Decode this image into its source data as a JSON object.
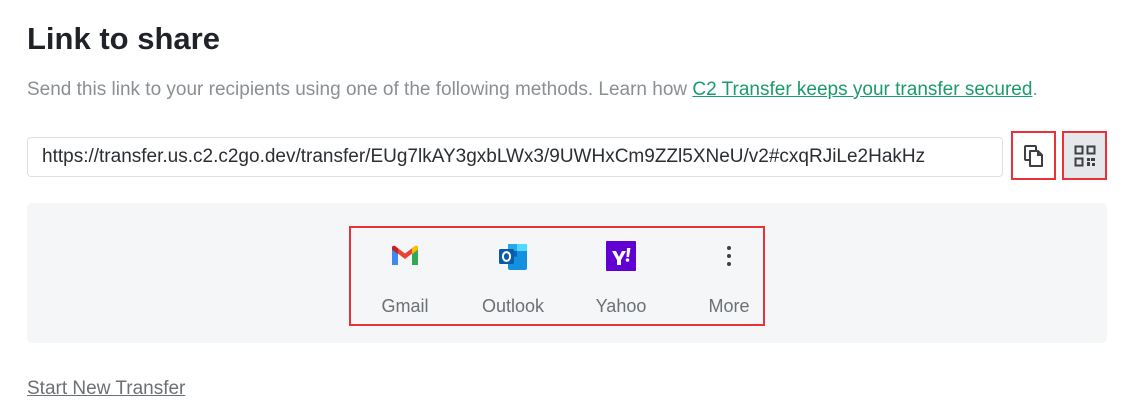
{
  "page": {
    "title": "Link to share",
    "description_prefix": "Send this link to your recipients using one of the following methods. Learn how ",
    "description_link": "C2 Transfer keeps your transfer secured",
    "description_suffix": "."
  },
  "link": {
    "value": "https://transfer.us.c2.c2go.dev/transfer/EUg7lkAY3gxbLWx3/9UWHxCm9ZZl5XNeU/v2#cxqRJiLe2HakHz"
  },
  "actions": {
    "copy_icon": "copy-icon",
    "qr_icon": "qr-code-icon"
  },
  "share": {
    "items": [
      {
        "label": "Gmail",
        "icon": "gmail-icon"
      },
      {
        "label": "Outlook",
        "icon": "outlook-icon"
      },
      {
        "label": "Yahoo",
        "icon": "yahoo-icon"
      },
      {
        "label": "More",
        "icon": "more-vertical-icon"
      }
    ]
  },
  "footer": {
    "start_new": "Start New Transfer"
  },
  "colors": {
    "accent_link": "#1a9b6b",
    "highlight_border": "#e8323a"
  }
}
